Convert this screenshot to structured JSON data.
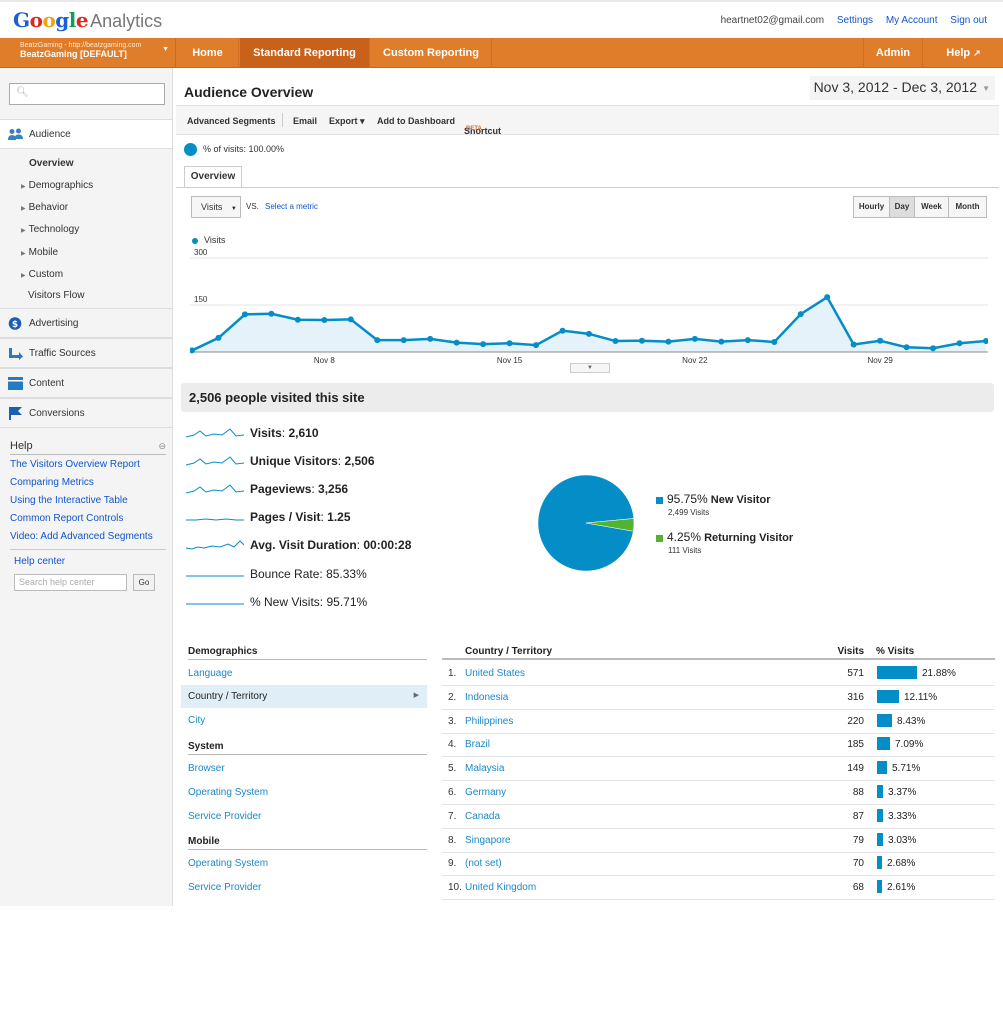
{
  "header": {
    "logo_google": "Google",
    "logo_product": "Analytics",
    "email": "heartnet02@gmail.com",
    "links": [
      "Settings",
      "My Account",
      "Sign out"
    ]
  },
  "nav": {
    "account_url": "BeatzGaming - http://beatzgaming.com",
    "account_name": "BeatzGaming [DEFAULT]",
    "items": [
      "Home",
      "Standard Reporting",
      "Custom Reporting"
    ],
    "right_items": [
      "Admin",
      "Help"
    ]
  },
  "sidebar": {
    "sections": [
      {
        "label": "Audience",
        "icon": "people-icon"
      },
      {
        "label": "Advertising",
        "icon": "dollar-icon"
      },
      {
        "label": "Traffic Sources",
        "icon": "arrows-icon"
      },
      {
        "label": "Content",
        "icon": "content-icon"
      },
      {
        "label": "Conversions",
        "icon": "flag-icon"
      }
    ],
    "audience_items": [
      "Overview",
      "Demographics",
      "Behavior",
      "Technology",
      "Mobile",
      "Custom",
      "Visitors Flow"
    ],
    "help_title": "Help",
    "help_links": [
      "The Visitors Overview Report",
      "Comparing Metrics",
      "Using the Interactive Table",
      "Common Report Controls",
      "Video: Add Advanced Segments"
    ],
    "help_center": "Help center",
    "help_search_placeholder": "Search help center",
    "go_label": "Go"
  },
  "report": {
    "title": "Audience Overview",
    "date_range": "Nov 3, 2012 - Dec 3, 2012",
    "toolbar": [
      "Advanced Segments",
      "Email",
      "Export ▾",
      "Add to Dashboard",
      "Shortcut"
    ],
    "beta_label": "BETA",
    "segment_text": "% of visits: 100.00%",
    "tab_label": "Overview",
    "metric_select": "Visits",
    "vs_label": "VS.",
    "select_metric_label": "Select a metric",
    "granularity": [
      "Hourly",
      "Day",
      "Week",
      "Month"
    ],
    "selected_granularity": "Day",
    "legend_label": "Visits",
    "accent_color": "#058dc7"
  },
  "chart_data": {
    "type": "area",
    "series": [
      {
        "name": "Visits",
        "values": [
          5,
          45,
          120,
          122,
          103,
          102,
          104,
          38,
          38,
          42,
          30,
          25,
          28,
          22,
          68,
          58,
          35,
          36,
          33,
          42,
          33,
          38,
          32,
          121,
          175,
          24,
          36,
          15,
          12,
          28,
          35
        ]
      }
    ],
    "x_labels": [
      "Nov 8",
      "Nov 15",
      "Nov 22",
      "Nov 29"
    ],
    "y_ticks": [
      150,
      300
    ],
    "ylim": [
      0,
      300
    ],
    "grid": true
  },
  "summary": {
    "headline": "2,506 people visited this site",
    "stats": [
      {
        "label": "Visits",
        "value": "2,610"
      },
      {
        "label": "Unique Visitors",
        "value": "2,506"
      },
      {
        "label": "Pageviews",
        "value": "3,256"
      },
      {
        "label": "Pages / Visit",
        "value": "1.25"
      },
      {
        "label": "Avg. Visit Duration",
        "value": "00:00:28"
      },
      {
        "label": "Bounce Rate",
        "value": "85.33%"
      },
      {
        "label": "% New Visits",
        "value": "95.71%"
      }
    ]
  },
  "pie": {
    "slices": [
      {
        "pct": "95.75%",
        "name": "New Visitor",
        "sub": "2,499 Visits",
        "value": 95.75,
        "color": "#058dc7"
      },
      {
        "pct": "4.25%",
        "name": "Returning Visitor",
        "sub": "111 Visits",
        "value": 4.25,
        "color": "#50b432"
      }
    ]
  },
  "demographics": {
    "heading": "Demographics",
    "links": [
      "Language",
      "Country / Territory",
      "City"
    ],
    "system_heading": "System",
    "system_links": [
      "Browser",
      "Operating System",
      "Service Provider"
    ],
    "mobile_heading": "Mobile",
    "mobile_links": [
      "Operating System",
      "Service Provider"
    ]
  },
  "country_table": {
    "headers": [
      "Country / Territory",
      "Visits",
      "% Visits"
    ],
    "rows": [
      {
        "rank": "1.",
        "country": "United States",
        "visits": "571",
        "pct": "21.88%",
        "value": 21.88
      },
      {
        "rank": "2.",
        "country": "Indonesia",
        "visits": "316",
        "pct": "12.11%",
        "value": 12.11
      },
      {
        "rank": "3.",
        "country": "Philippines",
        "visits": "220",
        "pct": "8.43%",
        "value": 8.43
      },
      {
        "rank": "4.",
        "country": "Brazil",
        "visits": "185",
        "pct": "7.09%",
        "value": 7.09
      },
      {
        "rank": "5.",
        "country": "Malaysia",
        "visits": "149",
        "pct": "5.71%",
        "value": 5.71
      },
      {
        "rank": "6.",
        "country": "Germany",
        "visits": "88",
        "pct": "3.37%",
        "value": 3.37
      },
      {
        "rank": "7.",
        "country": "Canada",
        "visits": "87",
        "pct": "3.33%",
        "value": 3.33
      },
      {
        "rank": "8.",
        "country": "Singapore",
        "visits": "79",
        "pct": "3.03%",
        "value": 3.03
      },
      {
        "rank": "9.",
        "country": "(not set)",
        "visits": "70",
        "pct": "2.68%",
        "value": 2.68
      },
      {
        "rank": "10.",
        "country": "United Kingdom",
        "visits": "68",
        "pct": "2.61%",
        "value": 2.61
      }
    ]
  }
}
